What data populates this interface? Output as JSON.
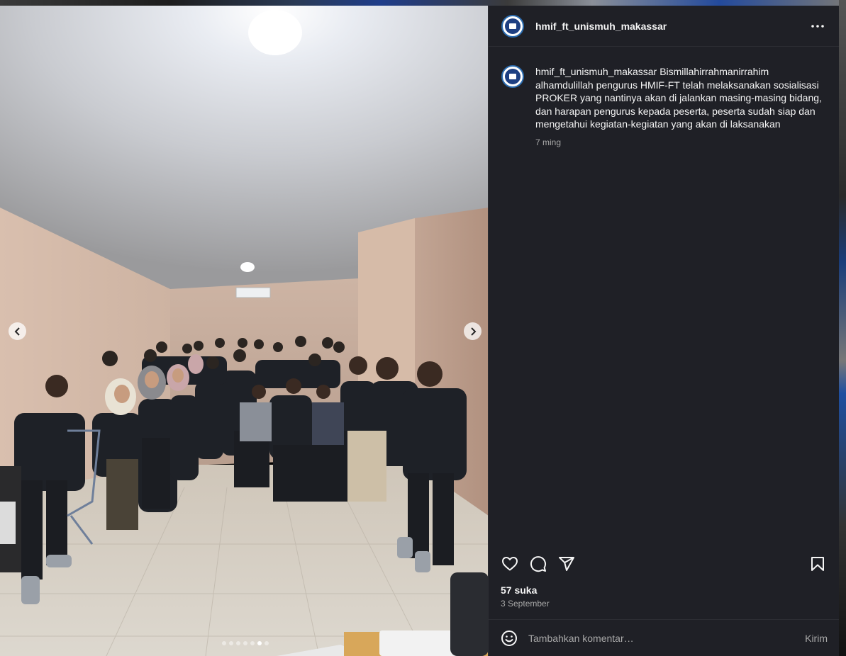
{
  "post": {
    "username": "hmif_ft_unismuh_makassar",
    "caption_user": "hmif_ft_unismuh_makassar",
    "caption": "Bismillahirrahmanirrahim alhamdulillah pengurus HMIF-FT telah melaksanakan sosialisasi PROKER yang nantinya akan di jalankan masing-masing bidang, dan harapan pengurus kepada peserta, peserta sudah siap dan mengetahui kegiatan-kegiatan yang akan di laksanakan",
    "time_ago": "7 ming",
    "likes": "57 suka",
    "date": "3 September"
  },
  "comment": {
    "placeholder": "Tambahkan komentar…",
    "post_label": "Kirim"
  },
  "carousel": {
    "total": 7,
    "active_index": 5
  },
  "icons": {
    "more": "more-horizontal-icon",
    "like": "heart-icon",
    "comment": "comment-bubble-icon",
    "share": "paper-plane-icon",
    "save": "bookmark-icon",
    "emoji": "smiley-icon",
    "prev": "chevron-left-icon",
    "next": "chevron-right-icon"
  },
  "colors": {
    "panel": "#1f2026",
    "text": "#f5f5f5",
    "muted": "#a8a8a8",
    "avatar_ring": "#2b6cb0"
  }
}
